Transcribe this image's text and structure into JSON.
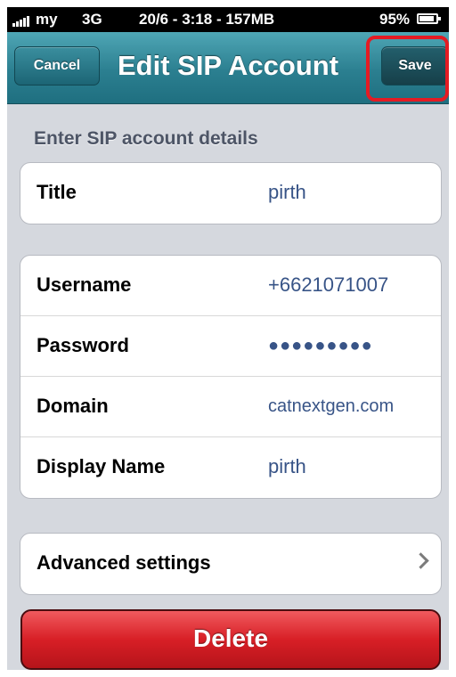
{
  "status_bar": {
    "carrier": "my",
    "network": "3G",
    "center_text": "20/6 - 3:18 - 157MB",
    "battery": "95%"
  },
  "nav": {
    "cancel_label": "Cancel",
    "title": "Edit SIP Account",
    "save_label": "Save"
  },
  "section_header": "Enter SIP account details",
  "title_group": [
    {
      "label": "Title",
      "value": "pirth"
    }
  ],
  "account_group": [
    {
      "label": "Username",
      "value": "+6621071007"
    },
    {
      "label": "Password",
      "value": "●●●●●●●●●"
    },
    {
      "label": "Domain",
      "value": "catnextgen.com"
    },
    {
      "label": "Display Name",
      "value": "pirth"
    }
  ],
  "advanced_label": "Advanced settings",
  "delete_label": "Delete",
  "colors": {
    "nav": "#2b7f90",
    "highlight": "#e41b23",
    "delete": "#d81f26",
    "value_text": "#385487"
  }
}
